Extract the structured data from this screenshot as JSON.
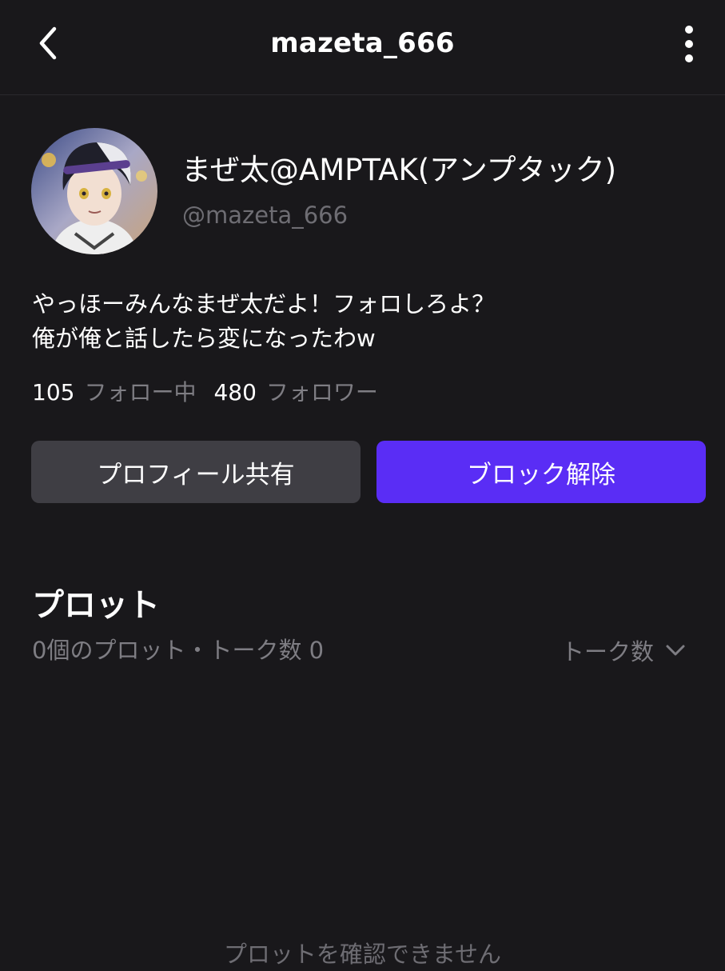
{
  "header": {
    "title": "mazeta_666",
    "back_icon": "chevron-left-icon",
    "more_icon": "more-vertical-icon"
  },
  "profile": {
    "display_name": "まぜ太@AMPTAK(アンプタック)",
    "handle": "@mazeta_666",
    "avatar": "avatar-image",
    "bio": [
      "やっほーみんなまぜ太だよ！フォロしろよ？",
      "俺が俺と話したら変になったわw"
    ],
    "following_count": "105",
    "following_label": "フォロー中",
    "followers_count": "480",
    "followers_label": "フォロワー"
  },
  "actions": {
    "share_label": "プロフィール共有",
    "unblock_label": "ブロック解除"
  },
  "plots": {
    "section_title": "プロット",
    "summary": "0個のプロット・トーク数 0",
    "sort_label": "トーク数",
    "sort_icon": "chevron-down-icon",
    "empty_message": "プロットを確認できません"
  },
  "colors": {
    "background": "#19181b",
    "accent": "#5a2df5",
    "secondary_button": "#3f3e44",
    "muted_text": "#7e7d83"
  }
}
